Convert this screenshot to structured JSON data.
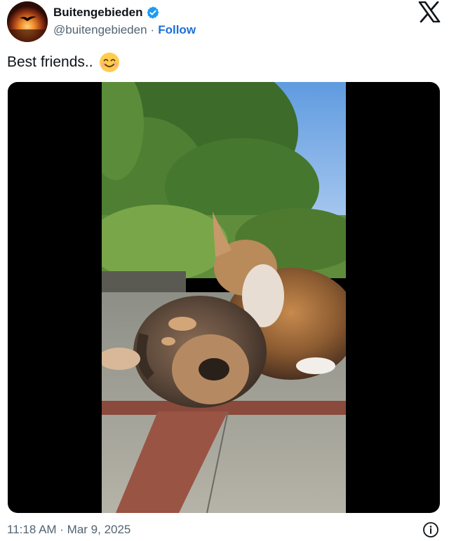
{
  "author": {
    "display_name": "Buitengebieden",
    "handle": "@buitengebieden",
    "separator": "·",
    "follow_label": "Follow",
    "verified": true,
    "avatar_icon": "bird-sunset-avatar",
    "verified_color": "#1d9bf0"
  },
  "tweet": {
    "text": "Best friends..",
    "emoji": "smiling-face-emoji"
  },
  "media": {
    "type": "video",
    "description_icon": "dog-and-cat-photo"
  },
  "footer": {
    "timestamp": "11:18 AM · Mar 9, 2025",
    "info_icon": "info-icon"
  },
  "brand": {
    "logo": "x-logo-icon",
    "link_color": "#1d6fd6",
    "muted_text_color": "#536471"
  }
}
